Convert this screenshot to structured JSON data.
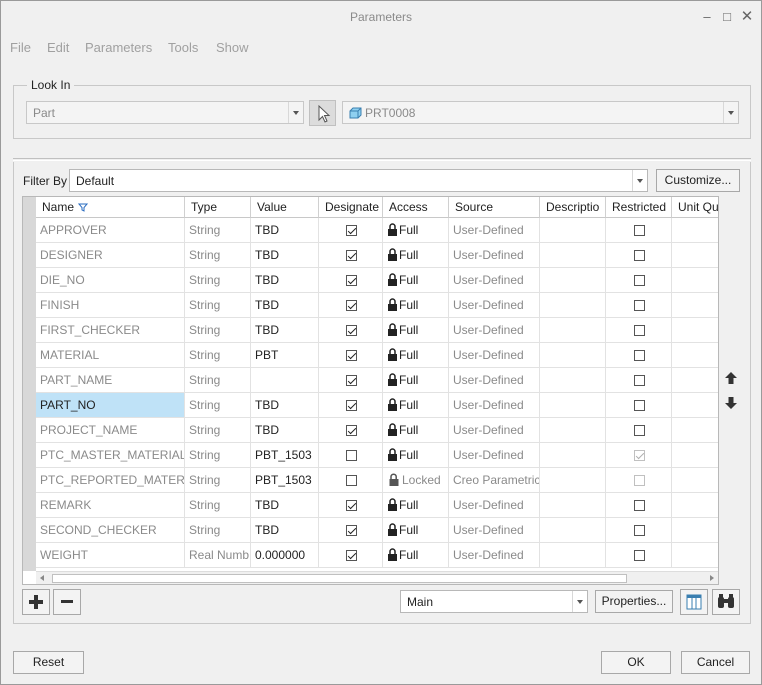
{
  "window": {
    "title": "Parameters"
  },
  "menu": [
    "File",
    "Edit",
    "Parameters",
    "Tools",
    "Show"
  ],
  "look_in": {
    "legend": "Look In",
    "type_value": "Part",
    "model_value": "PRT0008"
  },
  "filter": {
    "label": "Filter By",
    "value": "Default",
    "customize_label": "Customize..."
  },
  "table": {
    "columns": [
      "Name",
      "Type",
      "Value",
      "Designate",
      "Access",
      "Source",
      "Descriptio",
      "Restricted",
      "Unit Qu"
    ],
    "rows": [
      {
        "name": "APPROVER",
        "type": "String",
        "value": "TBD",
        "designate": true,
        "access": "Full",
        "source": "User-Defined",
        "restricted": false
      },
      {
        "name": "DESIGNER",
        "type": "String",
        "value": "TBD",
        "designate": true,
        "access": "Full",
        "source": "User-Defined",
        "restricted": false
      },
      {
        "name": "DIE_NO",
        "type": "String",
        "value": "TBD",
        "designate": true,
        "access": "Full",
        "source": "User-Defined",
        "restricted": false
      },
      {
        "name": "FINISH",
        "type": "String",
        "value": "TBD",
        "designate": true,
        "access": "Full",
        "source": "User-Defined",
        "restricted": false
      },
      {
        "name": "FIRST_CHECKER",
        "type": "String",
        "value": "TBD",
        "designate": true,
        "access": "Full",
        "source": "User-Defined",
        "restricted": false
      },
      {
        "name": "MATERIAL",
        "type": "String",
        "value": "PBT",
        "designate": true,
        "access": "Full",
        "source": "User-Defined",
        "restricted": false
      },
      {
        "name": "PART_NAME",
        "type": "String",
        "value": "",
        "designate": true,
        "access": "Full",
        "source": "User-Defined",
        "restricted": false
      },
      {
        "name": "PART_NO",
        "type": "String",
        "value": "TBD",
        "designate": true,
        "access": "Full",
        "source": "User-Defined",
        "restricted": false,
        "selected": true
      },
      {
        "name": "PROJECT_NAME",
        "type": "String",
        "value": "TBD",
        "designate": true,
        "access": "Full",
        "source": "User-Defined",
        "restricted": false
      },
      {
        "name": "PTC_MASTER_MATERIAL",
        "type": "String",
        "value": "PBT_1503",
        "designate": false,
        "access": "Full",
        "source": "User-Defined",
        "restricted": true,
        "restricted_disabled": true
      },
      {
        "name": "PTC_REPORTED_MATERIAL",
        "type": "String",
        "value": "PBT_1503",
        "designate": false,
        "access": "Locked",
        "source": "Creo Parametric",
        "restricted": false,
        "restricted_disabled": true
      },
      {
        "name": "REMARK",
        "type": "String",
        "value": "TBD",
        "designate": true,
        "access": "Full",
        "source": "User-Defined",
        "restricted": false
      },
      {
        "name": "SECOND_CHECKER",
        "type": "String",
        "value": "TBD",
        "designate": true,
        "access": "Full",
        "source": "User-Defined",
        "restricted": false
      },
      {
        "name": "WEIGHT",
        "type": "Real Numb",
        "value": "0.000000",
        "designate": true,
        "access": "Full",
        "source": "User-Defined",
        "restricted": false
      }
    ]
  },
  "bottom": {
    "view_value": "Main",
    "properties_label": "Properties...",
    "reset_label": "Reset",
    "ok_label": "OK",
    "cancel_label": "Cancel"
  },
  "colors": {
    "selected_row": "#bfe2f7",
    "disabled_text": "#8a8a8a"
  }
}
